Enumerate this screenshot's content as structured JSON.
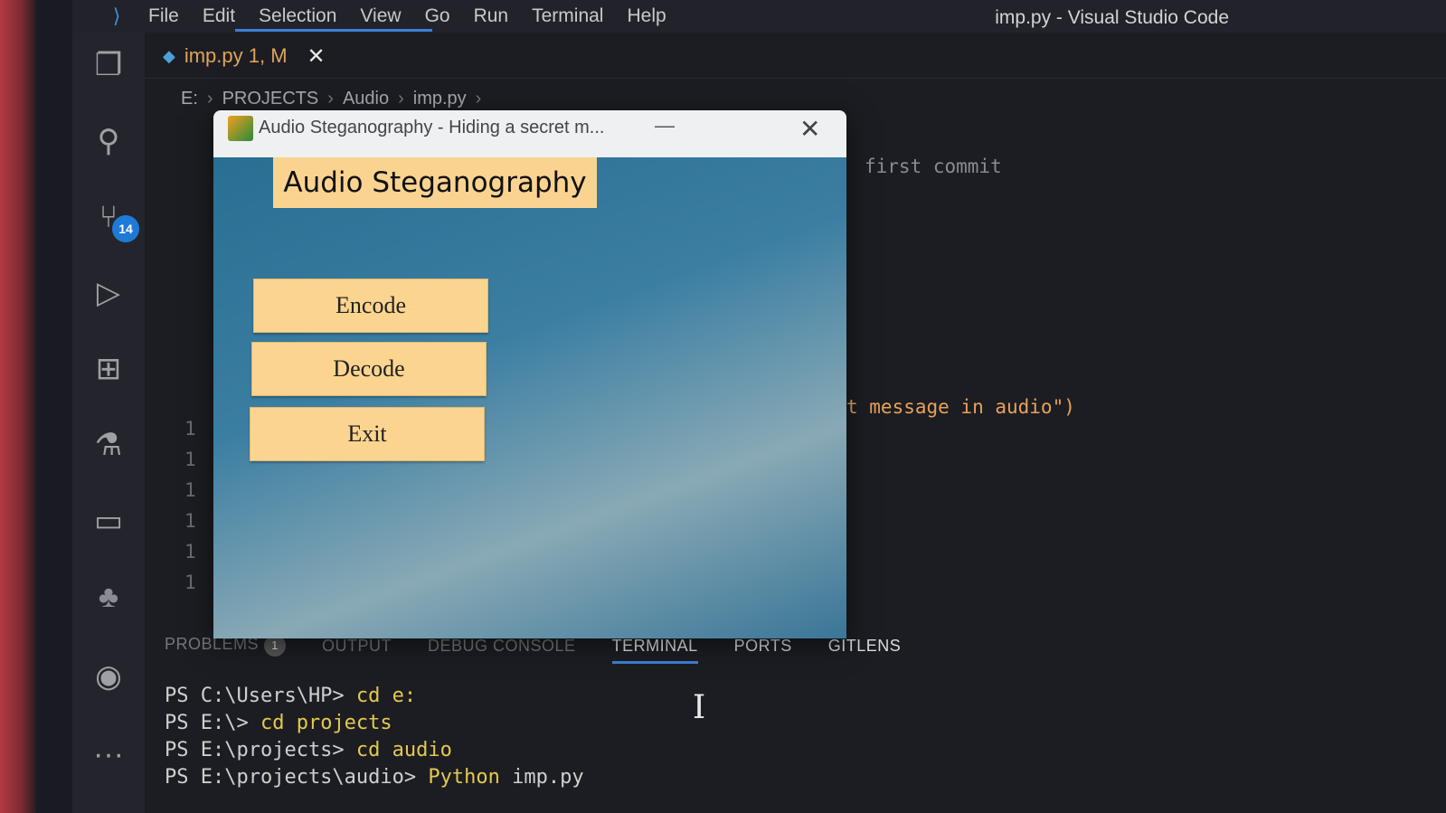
{
  "menubar": {
    "items": [
      "File",
      "Edit",
      "Selection",
      "View",
      "Go",
      "Run",
      "Terminal",
      "Help"
    ],
    "window_title": "imp.py - Visual Studio Code"
  },
  "activity_bar": {
    "icons": [
      "explorer-icon",
      "search-icon",
      "source-control-icon",
      "run-debug-icon",
      "extensions-icon",
      "testing-icon",
      "folder-icon",
      "python-icon",
      "gitlens-icon",
      "more-icon"
    ],
    "source_control_badge": "14"
  },
  "editor": {
    "tab_label": "imp.py 1, M",
    "breadcrumb": [
      "E:",
      "PROJECTS",
      "Audio",
      "imp.py"
    ],
    "code_fragments": {
      "commit_note": "first commit",
      "message_line": "t message in audio\")"
    },
    "line_numbers": [
      "1",
      "1",
      "1",
      "1",
      "1",
      "1"
    ]
  },
  "dialog": {
    "title": "Audio Steganography - Hiding a secret m...",
    "heading": "Audio Steganography",
    "buttons": [
      "Encode",
      "Decode",
      "Exit"
    ],
    "minimize_glyph": "—",
    "close_glyph": "✕"
  },
  "panel": {
    "tabs": [
      "PROBLEMS",
      "OUTPUT",
      "DEBUG CONSOLE",
      "TERMINAL",
      "PORTS",
      "GITLENS"
    ],
    "problems_count": "1",
    "active_tab": "TERMINAL"
  },
  "terminal": {
    "lines": [
      {
        "prompt": "PS C:\\Users\\HP> ",
        "command": "cd e:"
      },
      {
        "prompt": "PS E:\\> ",
        "command": "cd projects"
      },
      {
        "prompt": "PS E:\\projects> ",
        "command": "cd audio"
      },
      {
        "prompt": "PS E:\\projects\\audio> ",
        "command": "Python",
        "args": " imp.py"
      }
    ]
  },
  "colors": {
    "accent_blue": "#3c7fd6",
    "dialog_button": "#fbd58f",
    "terminal_command": "#e6c84e",
    "code_string": "#e7a25b"
  }
}
